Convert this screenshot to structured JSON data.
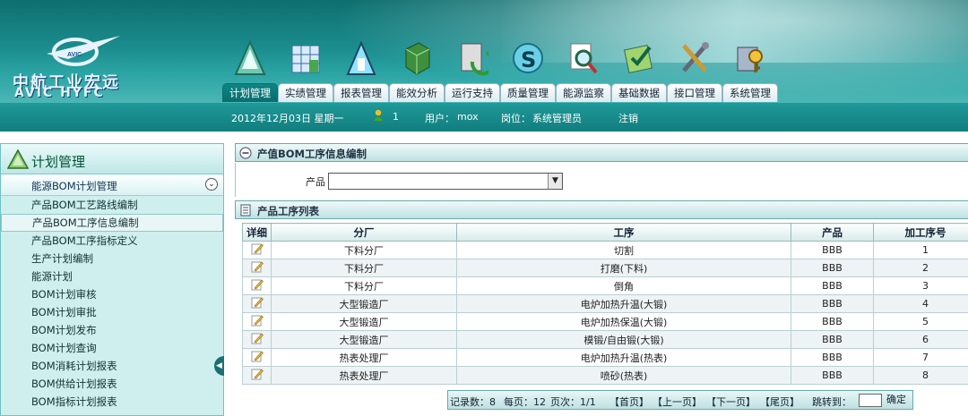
{
  "logo": {
    "cn": "中航工业宏远",
    "en": "AVIC HYFC",
    "badge": "AVIC"
  },
  "nav": [
    {
      "label": "计划管理",
      "icon": "triangle-icon",
      "active": true
    },
    {
      "label": "实绩管理",
      "icon": "grid-chart-icon"
    },
    {
      "label": "报表管理",
      "icon": "report-triangle-icon"
    },
    {
      "label": "能效分析",
      "icon": "cube-icon"
    },
    {
      "label": "运行支持",
      "icon": "document-arrow-icon"
    },
    {
      "label": "质量管理",
      "icon": "quality-s-icon"
    },
    {
      "label": "能源监察",
      "icon": "magnifier-icon"
    },
    {
      "label": "基础数据",
      "icon": "data-check-icon"
    },
    {
      "label": "接口管理",
      "icon": "tools-icon"
    },
    {
      "label": "系统管理",
      "icon": "key-lock-icon"
    }
  ],
  "infobar": {
    "date": "2012年12月03日 星期一",
    "online_count": "1",
    "user_label": "用户：",
    "user": "mox",
    "role_label": "岗位：",
    "role": "系统管理员",
    "logout": "注销"
  },
  "sidebar": {
    "title": "计划管理",
    "group": "能源BOM计划管理",
    "items": [
      "产品BOM工艺路线编制",
      "产品BOM工序信息编制",
      "产品BOM工序指标定义",
      "生产计划编制",
      "能源计划",
      "BOM计划审核",
      "BOM计划审批",
      "BOM计划发布",
      "BOM计划查询",
      "BOM消耗计划报表",
      "BOM供给计划报表",
      "BOM指标计划报表"
    ],
    "selected_index": 1
  },
  "main": {
    "panel_title": "产值BOM工序信息编制",
    "product_label": "产品",
    "product_value": "",
    "list_title": "产品工序列表",
    "columns": [
      "详细",
      "分厂",
      "工序",
      "产品",
      "加工序号"
    ],
    "rows": [
      [
        "下料分厂",
        "切割",
        "BBB",
        "1"
      ],
      [
        "下料分厂",
        "打磨(下料)",
        "BBB",
        "2"
      ],
      [
        "下料分厂",
        "倒角",
        "BBB",
        "3"
      ],
      [
        "大型锻造厂",
        "电炉加热升温(大锻)",
        "BBB",
        "4"
      ],
      [
        "大型锻造厂",
        "电炉加热保温(大锻)",
        "BBB",
        "5"
      ],
      [
        "大型锻造厂",
        "模锻/自由锻(大锻)",
        "BBB",
        "6"
      ],
      [
        "热表处理厂",
        "电炉加热升温(热表)",
        "BBB",
        "7"
      ],
      [
        "热表处理厂",
        "喷砂(热表)",
        "BBB",
        "8"
      ]
    ],
    "pager": {
      "records": "记录数：8",
      "per_page": "每页：12",
      "pages": "页次：1/1",
      "first": "【首页】",
      "prev": "【上一页】",
      "next": "【下一页】",
      "last": "【尾页】",
      "jump": "跳转到：",
      "confirm": "确定"
    }
  }
}
